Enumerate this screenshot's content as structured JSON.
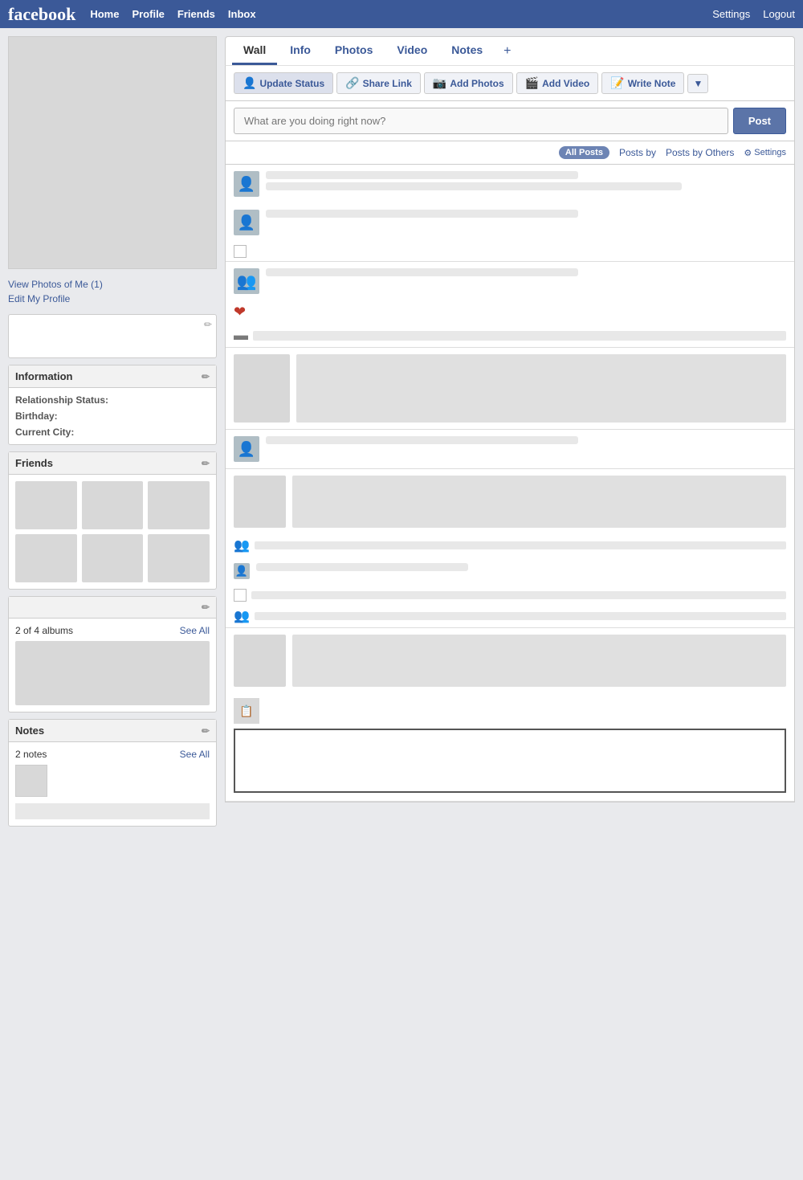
{
  "topnav": {
    "logo": "facebook",
    "links": [
      "Home",
      "Profile",
      "Friends",
      "Inbox"
    ],
    "right_links": [
      "Settings",
      "Logout"
    ]
  },
  "sidebar": {
    "profile_links": [
      "View Photos of Me (1)",
      "Edit My Profile"
    ],
    "information": {
      "title": "Information",
      "fields": [
        {
          "label": "Relationship Status:",
          "value": ""
        },
        {
          "label": "Birthday:",
          "value": ""
        },
        {
          "label": "Current City:",
          "value": ""
        }
      ]
    },
    "friends": {
      "title": "Friends"
    },
    "albums": {
      "count": "2 of 4 albums",
      "see_all": "See All"
    },
    "notes": {
      "title": "Notes",
      "count": "2 notes",
      "see_all": "See All"
    }
  },
  "tabs": {
    "items": [
      "Wall",
      "Info",
      "Photos",
      "Video",
      "Notes"
    ],
    "active": "Wall",
    "plus": "+"
  },
  "actions": {
    "update_status": "Update Status",
    "share_link": "Share Link",
    "add_photos": "Add Photos",
    "add_video": "Add Video",
    "write_note": "Write Note"
  },
  "post_box": {
    "placeholder": "What are you doing right now?",
    "button": "Post"
  },
  "filter": {
    "all_posts": "All Posts",
    "posts_by": "Posts by",
    "posts_by_others": "Posts by Others",
    "settings": "Settings"
  }
}
